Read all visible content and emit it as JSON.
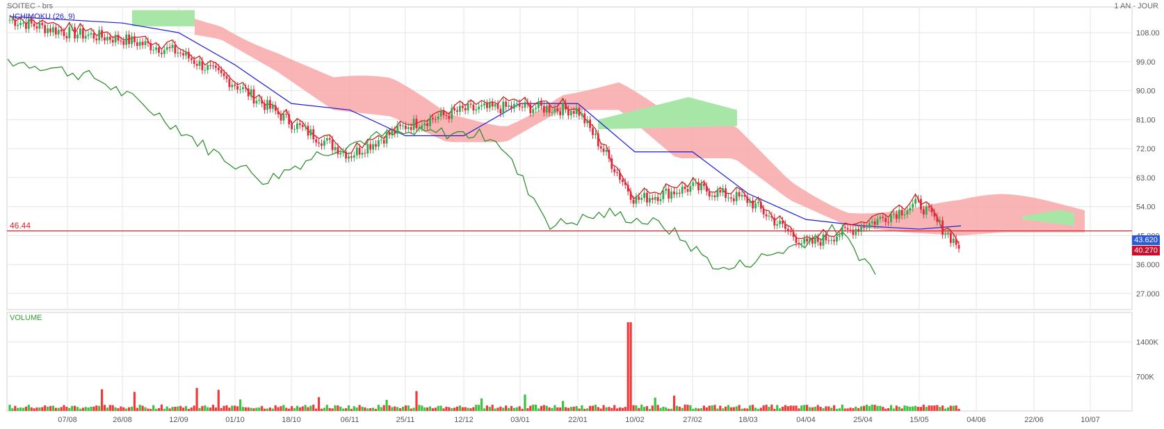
{
  "header": {
    "instrument": "SOITEC - brs",
    "period": "1 AN - JOUR",
    "indicator": "ICHIMOKU (26, 9)"
  },
  "price_badges": {
    "current": "43.620",
    "low": "40.270",
    "current_color": "#2a5bd7",
    "low_color": "#c8102e"
  },
  "reference_line": {
    "label": "46.44",
    "value": 46.44,
    "color": "#e8202a"
  },
  "volume_label": "VOLUME",
  "colors": {
    "up": "#2fa84f",
    "down": "#e0283a",
    "tenkan": "#d01010",
    "kijun": "#1a1ad6",
    "chikou": "#238a23",
    "kumo_bear": "#f8a8a8",
    "kumo_bull": "#a8e6a8",
    "volume_up": "#3cc23c",
    "volume_down": "#f03a3a",
    "grid": "#e4e4e4"
  },
  "chart_data": [
    {
      "type": "candlestick",
      "title": "SOITEC - brs",
      "period": "1 AN - JOUR",
      "indicator": "ICHIMOKU (26, 9)",
      "x_tick_labels": [
        "07/08",
        "26/08",
        "12/09",
        "01/10",
        "18/10",
        "06/11",
        "25/11",
        "12/12",
        "03/01",
        "22/01",
        "10/02",
        "27/02",
        "18/03",
        "04/04",
        "25/04",
        "15/05",
        "04/06",
        "22/06",
        "10/07"
      ],
      "y_tick_labels": [
        "108.00",
        "99.00",
        "90.00",
        "81.00",
        "72.00",
        "63.00",
        "54.00",
        "45.000",
        "36.000",
        "27.000"
      ],
      "ylim": [
        22,
        116
      ],
      "reference_line": 46.44,
      "price_badges": [
        "43.620",
        "40.270"
      ],
      "close_path": [
        [
          "07/08",
          108
        ],
        [
          "26/08",
          106
        ],
        [
          "12/09",
          102
        ],
        [
          "01/10",
          92
        ],
        [
          "18/10",
          80
        ],
        [
          "06/11",
          70
        ],
        [
          "25/11",
          79
        ],
        [
          "12/12",
          84
        ],
        [
          "03/01",
          85
        ],
        [
          "22/01",
          84
        ],
        [
          "10/02",
          56
        ],
        [
          "27/02",
          60
        ],
        [
          "18/03",
          56
        ],
        [
          "04/04",
          42
        ],
        [
          "25/04",
          48
        ],
        [
          "15/05",
          55
        ],
        [
          "last",
          41
        ]
      ],
      "kijun_path": [
        [
          "07/08",
          112
        ],
        [
          "26/08",
          111
        ],
        [
          "12/09",
          108
        ],
        [
          "01/10",
          98
        ],
        [
          "18/10",
          86
        ],
        [
          "06/11",
          84
        ],
        [
          "25/11",
          76
        ],
        [
          "12/12",
          76
        ],
        [
          "03/01",
          86
        ],
        [
          "22/01",
          86
        ],
        [
          "10/02",
          71
        ],
        [
          "27/02",
          71
        ],
        [
          "18/03",
          58
        ],
        [
          "04/04",
          50
        ],
        [
          "25/04",
          48
        ],
        [
          "15/05",
          47
        ],
        [
          "last",
          48
        ]
      ],
      "grid": true
    },
    {
      "type": "bar",
      "title": "VOLUME",
      "y_tick_labels": [
        "1400K",
        "700K"
      ],
      "ylim": [
        0,
        2000000
      ],
      "max_bar": 1800000,
      "grid": true
    }
  ]
}
